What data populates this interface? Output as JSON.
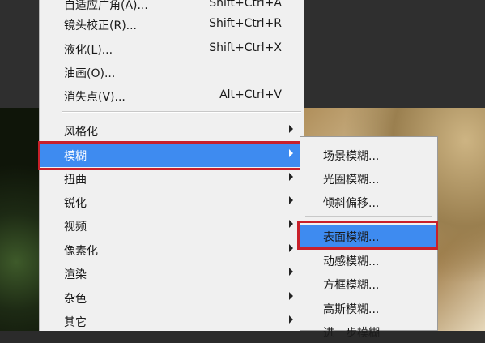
{
  "filter_menu": {
    "items": [
      {
        "label": "自适应广角(A)...",
        "shortcut": "Shift+Ctrl+A"
      },
      {
        "label": "镜头校正(R)...",
        "shortcut": "Shift+Ctrl+R"
      },
      {
        "label": "液化(L)...",
        "shortcut": "Shift+Ctrl+X"
      },
      {
        "label": "油画(O)...",
        "shortcut": ""
      },
      {
        "label": "消失点(V)...",
        "shortcut": "Alt+Ctrl+V"
      },
      {
        "label": "风格化"
      },
      {
        "label": "模糊",
        "selected": true
      },
      {
        "label": "扭曲"
      },
      {
        "label": "锐化"
      },
      {
        "label": "视频"
      },
      {
        "label": "像素化"
      },
      {
        "label": "渲染"
      },
      {
        "label": "杂色"
      },
      {
        "label": "其它"
      }
    ]
  },
  "blur_submenu": {
    "items": [
      {
        "label": "场景模糊..."
      },
      {
        "label": "光圈模糊..."
      },
      {
        "label": "倾斜偏移..."
      },
      {
        "label": "表面模糊...",
        "selected": true
      },
      {
        "label": "动感模糊..."
      },
      {
        "label": "方框模糊..."
      },
      {
        "label": "高斯模糊..."
      },
      {
        "label": "进一步模糊"
      }
    ]
  },
  "colors": {
    "highlight": "#3e8bf0",
    "annotation_box": "#c8202a",
    "menu_bg": "#f0f0f0"
  }
}
